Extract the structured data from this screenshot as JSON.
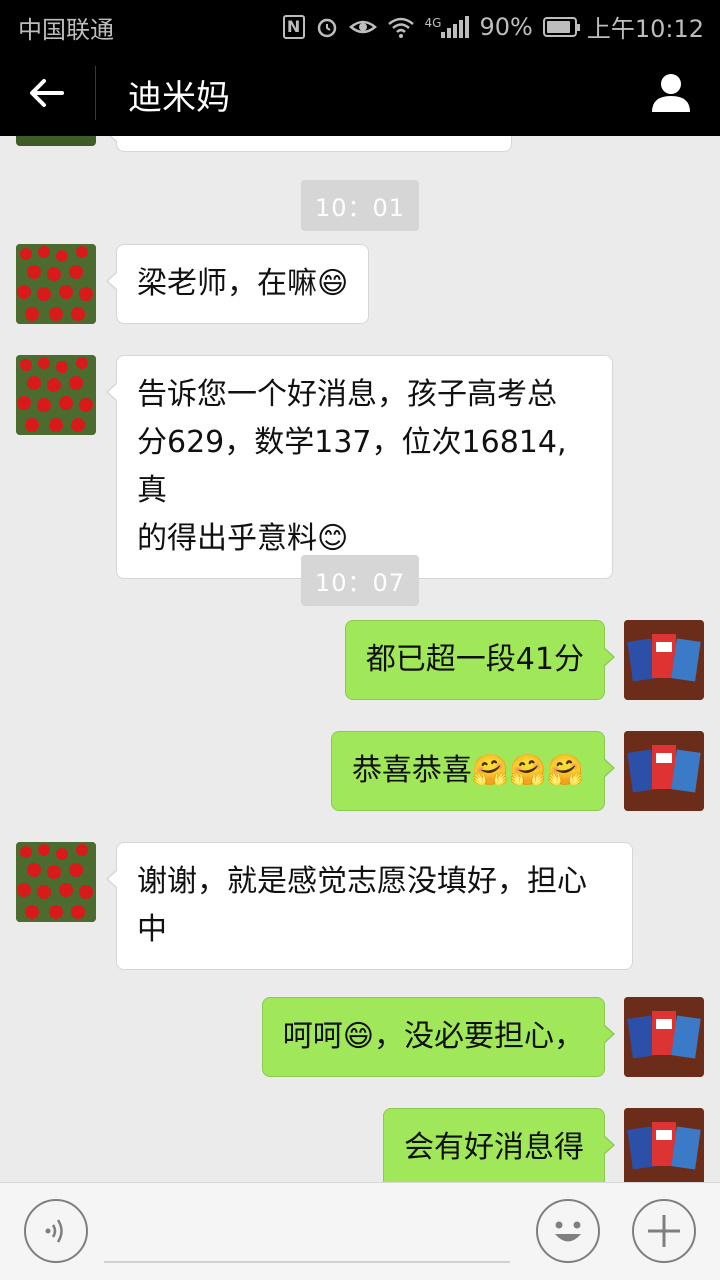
{
  "status_bar": {
    "carrier": "中国联通",
    "network": "4G",
    "battery": "90%",
    "battery_level": 0.9,
    "time": "上午10:12",
    "icons": [
      "nfc-icon",
      "alarm-icon",
      "eye-icon",
      "wifi-icon",
      "signal-icon",
      "battery-icon"
    ]
  },
  "header": {
    "title": "迪米妈",
    "back_icon": "back-arrow-icon",
    "profile_icon": "profile-icon"
  },
  "timestamps": [
    "10：01",
    "10：07"
  ],
  "messages": [
    {
      "side": "in",
      "text": "梁老师，在嘛😄"
    },
    {
      "side": "in",
      "line1": "告诉您一个好消息，孩子高考总",
      "line2": "分629，数学137，位次16814,真",
      "line3": "的得出乎意料😊"
    },
    {
      "side": "out",
      "text": "都已超一段41分"
    },
    {
      "side": "out",
      "text": "恭喜恭喜🤗🤗🤗"
    },
    {
      "side": "in",
      "line1": "谢谢，就是感觉志愿没填好，担心",
      "line2": "中"
    },
    {
      "side": "out",
      "text": "呵呵😄，没必要担心，"
    },
    {
      "side": "out",
      "text": "会有好消息得"
    }
  ],
  "input_bar": {
    "voice_icon": "voice-icon",
    "emoji_icon": "emoji-icon",
    "plus_icon": "plus-icon",
    "placeholder": ""
  },
  "colors": {
    "bar_bg": "#000000",
    "chat_bg": "#ebebeb",
    "bubble_in": "#ffffff",
    "bubble_out": "#a0e75a",
    "timestamp_bg": "#d6d6d6"
  }
}
